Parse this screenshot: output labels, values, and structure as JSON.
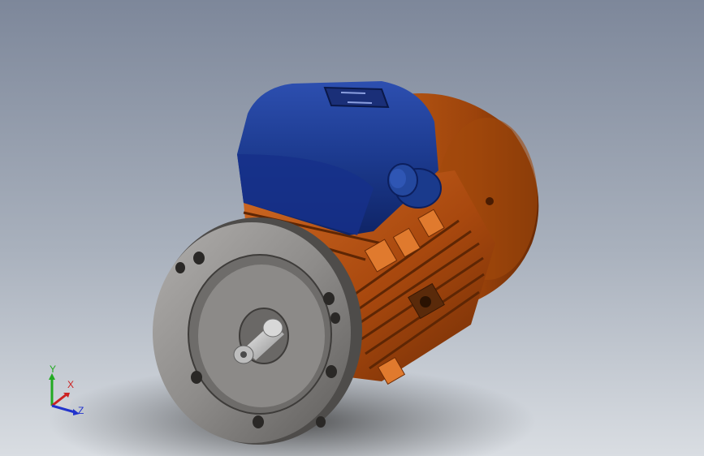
{
  "viewport": {
    "model": "electric-motor",
    "colors": {
      "background_top": "#7d879a",
      "background_bottom": "#d9dde2",
      "motor_housing": "#b4500f",
      "terminal_box": "#1a3a8c",
      "flange": "#8a8886",
      "shaft": "#c8c8c8"
    }
  },
  "triad": {
    "x_label": "X",
    "y_label": "Y",
    "z_label": "Z",
    "x_color": "#cc2222",
    "y_color": "#22aa22",
    "z_color": "#2233cc"
  }
}
